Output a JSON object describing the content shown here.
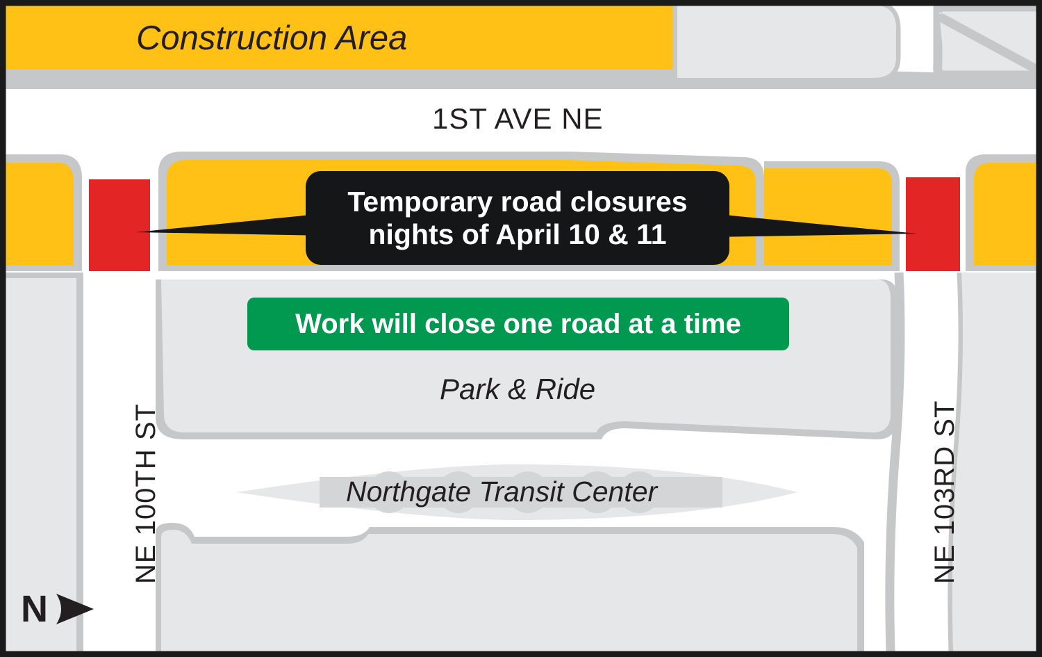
{
  "map": {
    "title_area_label": "Construction Area",
    "avenue_label": "1ST AVE NE",
    "facility_label": "Park & Ride",
    "transit_label": "Northgate Transit Center",
    "street_left_label": "NE 100TH ST",
    "street_right_label": "NE 103RD ST",
    "north_label": "N",
    "north_arrow_icon": "arrow-right-icon"
  },
  "callout": {
    "line1": "Temporary road closures",
    "line2": "nights of April 10 & 11",
    "background": "#141618",
    "text_color": "#FFFFFF"
  },
  "banner": {
    "text": "Work will close one road at a time",
    "background": "#00994F",
    "text_color": "#FFFFFF"
  },
  "colors": {
    "construction_yellow": "#FFC116",
    "closure_red": "#E32526",
    "parcel_gray": "#E6E7E8",
    "road_casing_gray": "#C6C7C9",
    "transit_bay_gray": "#D4D5D7",
    "road_white": "#FFFFFF",
    "border_black": "#1A1A1A",
    "text_dark": "#231F20"
  },
  "legend_semantics": {
    "yellow_meaning": "Construction Area",
    "red_meaning": "Temporary road closure location"
  }
}
